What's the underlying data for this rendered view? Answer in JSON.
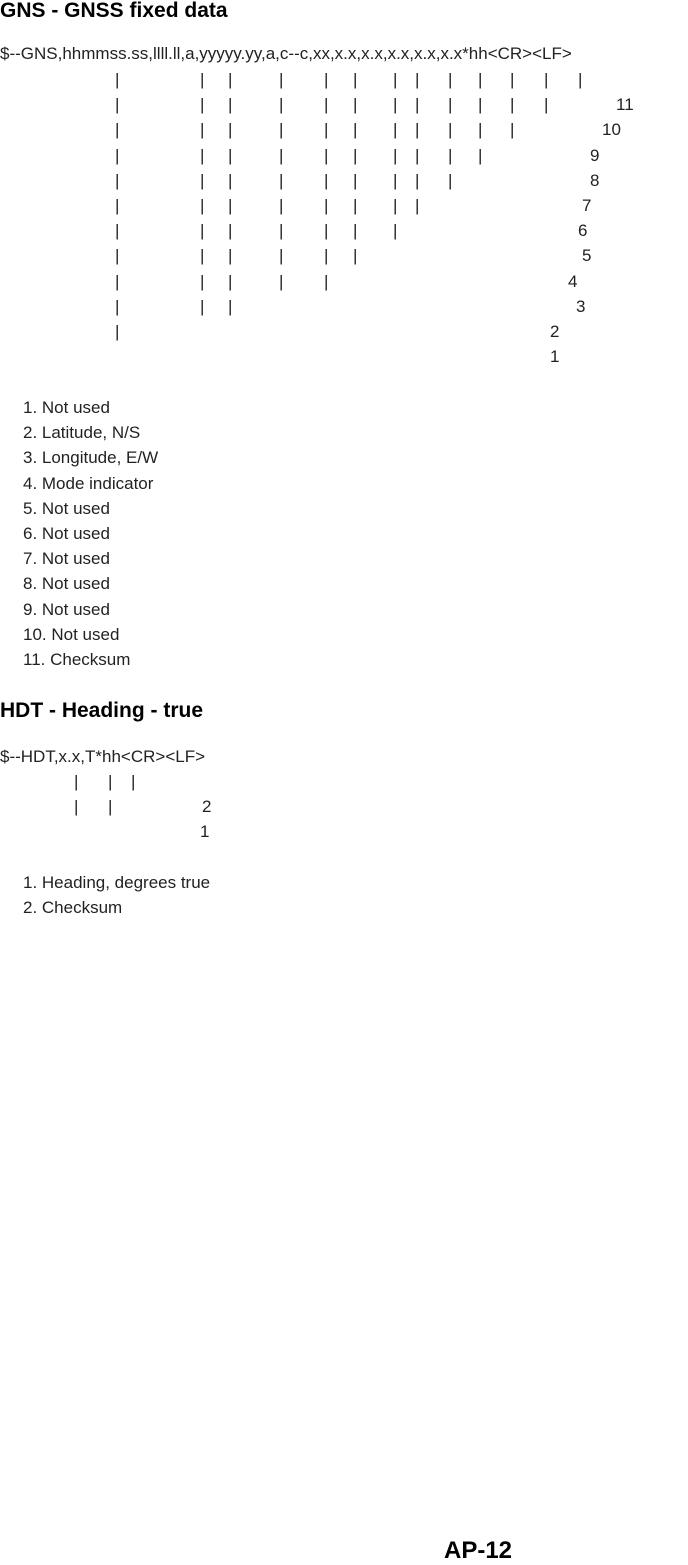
{
  "sections": [
    {
      "title": "GNS - GNSS fixed data",
      "sentence": "$--GNS,hhmmss.ss,llll.ll,a,yyyyy.yy,a,c--c,xx,x.x,x.x,x.x,x.x,x.x*hh<CR><LF>",
      "fields": [
        "1. Not used",
        "2. Latitude, N/S",
        "3. Longitude, E/W",
        "4. Mode indicator",
        "5. Not used",
        "6. Not used",
        "7. Not used",
        "8. Not used",
        "9. Not used",
        "10. Not used",
        "11. Checksum"
      ]
    },
    {
      "title": "HDT - Heading - true",
      "sentence": "$--HDT,x.x,T*hh<CR><LF>",
      "fields": [
        "1. Heading, degrees true",
        "2. Checksum"
      ]
    }
  ],
  "page_number": "AP-12"
}
